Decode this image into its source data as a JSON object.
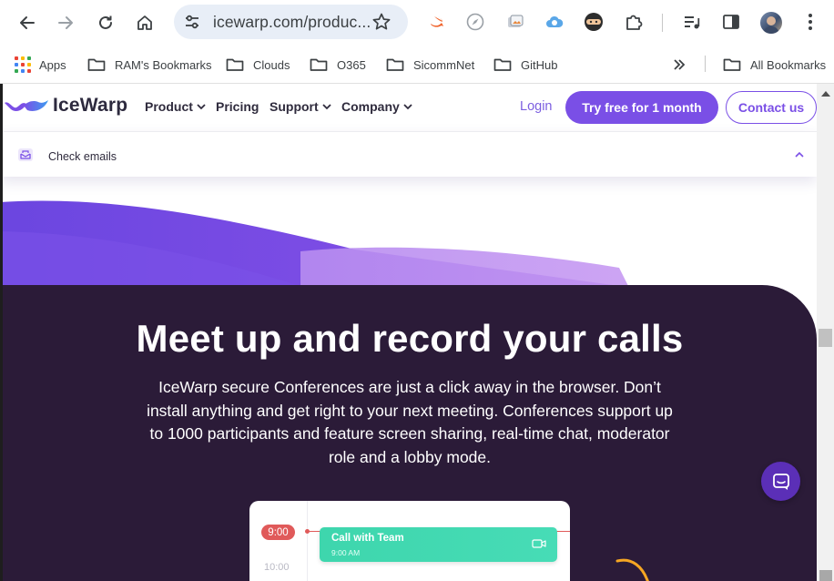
{
  "browser": {
    "url": "icewarp.com/produc...",
    "bookmarks": [
      {
        "label": "Apps"
      },
      {
        "label": "RAM's Bookmarks"
      },
      {
        "label": "Clouds"
      },
      {
        "label": "O365"
      },
      {
        "label": "SicommNet"
      },
      {
        "label": "GitHub"
      }
    ],
    "all_bookmarks": "All Bookmarks"
  },
  "site": {
    "logo_text": "IceWarp",
    "nav": [
      {
        "label": "Product",
        "dropdown": true
      },
      {
        "label": "Pricing",
        "dropdown": false
      },
      {
        "label": "Support",
        "dropdown": true
      },
      {
        "label": "Company",
        "dropdown": true
      }
    ],
    "login": "Login",
    "try_free": "Try free for 1 month",
    "contact": "Contact us",
    "subnav_label": "Check emails",
    "accent": "#7a4fe6"
  },
  "hero": {
    "headline": "Meet up and record your calls",
    "paragraph": "IceWarp secure Conferences are just a click away in the browser. Don’t install anything and get right to your next meeting. Conferences support up to 1000 participants and feature screen sharing, real-time chat, moderator role and a lobby mode.",
    "background": "#2b1b38"
  },
  "calendar": {
    "current_time": "9:00",
    "next_time": "10:00",
    "event_title": "Call with Team",
    "event_time": "9:00 AM",
    "event_color": "#3ed6ad"
  }
}
